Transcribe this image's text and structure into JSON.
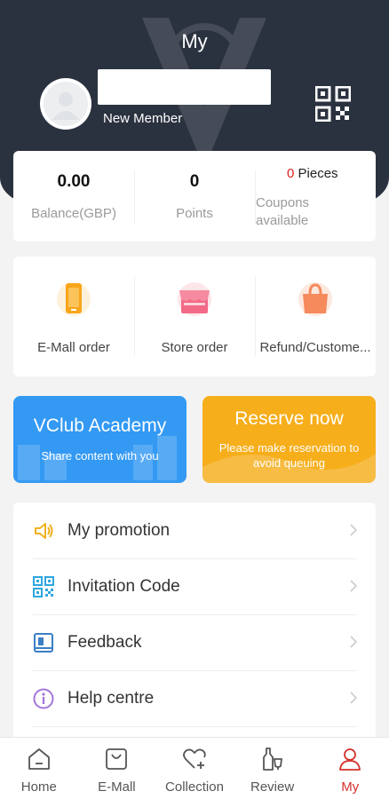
{
  "header": {
    "title": "My",
    "member_level": "New Member"
  },
  "stats": {
    "balance_value": "0.00",
    "balance_label": "Balance(GBP)",
    "points_value": "0",
    "points_label": "Points",
    "coupons_count": "0",
    "coupons_unit": "Pieces",
    "coupons_label": "Coupons available"
  },
  "orders": [
    {
      "label": "E-Mall order",
      "icon": "phone-icon"
    },
    {
      "label": "Store order",
      "icon": "store-icon"
    },
    {
      "label": "Refund/Custome...",
      "icon": "shopping-bag-icon"
    }
  ],
  "promos": {
    "academy": {
      "title": "VClub Academy",
      "subtitle": "Share content with you"
    },
    "reserve": {
      "title": "Reserve now",
      "subtitle": "Please make reservation to avoid queuing"
    }
  },
  "menu": [
    {
      "label": "My promotion",
      "icon": "speaker-icon"
    },
    {
      "label": "Invitation Code",
      "icon": "qr-code-icon"
    },
    {
      "label": "Feedback",
      "icon": "feedback-icon"
    },
    {
      "label": "Help centre",
      "icon": "info-icon"
    }
  ],
  "tabs": [
    {
      "label": "Home",
      "icon": "home-icon"
    },
    {
      "label": "E-Mall",
      "icon": "shopping-bag-icon"
    },
    {
      "label": "Collection",
      "icon": "heart-icon"
    },
    {
      "label": "Review",
      "icon": "bottles-icon"
    },
    {
      "label": "My",
      "icon": "person-icon",
      "active": true
    }
  ],
  "colors": {
    "header_bg": "#2b323f",
    "accent_red": "#d3312b",
    "academy_blue": "#3399f3",
    "reserve_orange": "#f6ae1b",
    "order_orange": "#f9a51a",
    "store_pink": "#f26a86",
    "bag_coral": "#f58a5c"
  }
}
